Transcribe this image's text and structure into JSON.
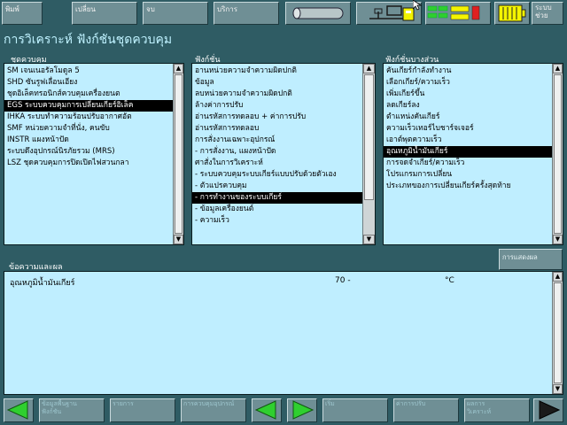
{
  "toolbar": {
    "buttons": [
      "พิมพ์",
      "เปลี่ยน",
      "จบ",
      "บริการ"
    ],
    "help_label": "ระบบ\nช่วย"
  },
  "page_title": "การวิเคราะห์  ฟังก์ชันชุดควบคุม",
  "panels": {
    "control_units": {
      "header": "ชุดควบคุม",
      "items": [
        "SM เจนเนอรัลโมดูล 5",
        "SHD ซันรูฟเลื่อนเอียง",
        "ชุดอิเล็คทรอนิกส์ควบคุมเครื่องยนต",
        "EGS ระบบควบคุมการเปลี่ยนเกียร์อิเล็ค",
        "IHKA ระบบทำความร้อนปรับอากาศอัต",
        "SMF หน่วยความจำที่นั่ง, คนขับ",
        "INSTR แผงหน้าปัด",
        "ระบบดึงอุปกรณ์นิรภัยรวม (MRS)",
        "LSZ ชุดควบคุมการปิดเปิดไฟสวนกลา"
      ],
      "selected_index": 3
    },
    "functions": {
      "header": "ฟังก์ชั่น",
      "items": [
        "อานหน่วยความจำความผิดปกติ",
        "ข้อมูล",
        "ลบหน่วยความจำความผิดปกติ",
        "ล้างค่าการปรับ",
        "อ่านรหัสการทดลอบ + ค่าการปรับ",
        "อ่านรหัสการทดลอบ",
        "การสั่งงานเฉพาะอุปกรณ์",
        "- การสั่งงาน, แผงหน้าปัด",
        "ศาสั่งในการวิเคราะห์",
        "- ระบบควบคุมระบบเกียร์แบบปรับด้วยตัวเอง",
        "- ตัวแปรควบคุม",
        "- การทำงานของระบบเกียร์",
        "- ข้อมูลเครื่องยนต์",
        "- ความเร็ว"
      ],
      "selected_index": 11
    },
    "sub_functions": {
      "header": "ฟังก์ชั่นบางส่วน",
      "items": [
        "คันเกียร์กำลังทำงาน",
        "เลือกเกียร์/ความเร็ว",
        "เพิ่มเกียร์ขึ้น",
        "ลดเกียร์ลง",
        "ตำแหน่งคันเกียร์",
        "ความเร็วเทอร์ไบชาร์จเจอร์",
        "เอาต์พุตความเร็ว",
        "อุณหภูมิน้ำมันเกียร์",
        "การจดจำเกียร์/ความเร็ว",
        "โปรแกรมการเปลี่ยน",
        "ประเภทของการเปลี่ยนเกียร์ครั้งสุดท้าย"
      ],
      "selected_index": 7
    }
  },
  "message_section": {
    "header": "ข้อความและผล",
    "display_button": "การแสดงผล",
    "result": {
      "label": "อุณหภูมิน้ำมันเกียร์",
      "value": "70 -",
      "unit": "°C"
    }
  },
  "bottom_bar": {
    "buttons": [
      "ข้อมูลพื้นฐาน\nฟังก์ชัน",
      "รายการ",
      "การควบคุมอุปกรณ์",
      "เริ่ม",
      "ค่าการปรับ",
      "ผลการ\nวิเคราะห์"
    ]
  },
  "colors": {
    "background": "#2f5c64",
    "list_background": "#bfeeff",
    "arrow_green": "#2fcf2f",
    "battery_yellow": "#f4f400"
  }
}
